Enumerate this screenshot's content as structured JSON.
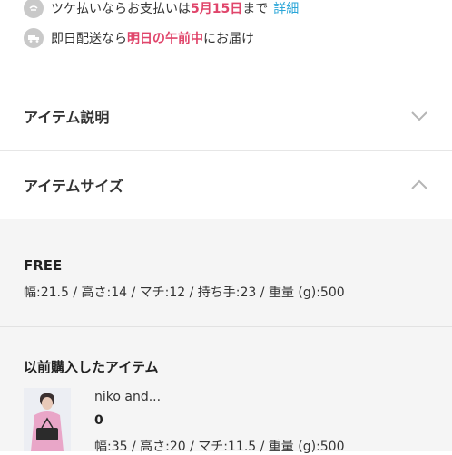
{
  "payment_notice": {
    "text_before": "ツケ払いならお支払いは",
    "date": "5月15日",
    "text_after": "まで",
    "link": "詳細"
  },
  "delivery_notice": {
    "text_before": "即日配送なら",
    "highlight": "明日の午前中",
    "text_after": "にお届け"
  },
  "accordion": {
    "description_title": "アイテム説明",
    "size_title": "アイテムサイズ"
  },
  "size": {
    "label": "FREE",
    "spec": "幅:21.5 / 高さ:14 / マチ:12 / 持ち手:23 / 重量 (g):500"
  },
  "previous": {
    "title": "以前購入したアイテム",
    "brand": "niko and...",
    "size": "0",
    "spec": "幅:35 / 高さ:20 / マチ:11.5 / 重量 (g):500"
  },
  "colors": {
    "highlight": "#e0456b",
    "link": "#2aa6d8",
    "section_bg": "#f5f5f5"
  },
  "icons": [
    "tsuke-icon",
    "truck-icon",
    "chevron-down-icon",
    "chevron-up-icon"
  ]
}
